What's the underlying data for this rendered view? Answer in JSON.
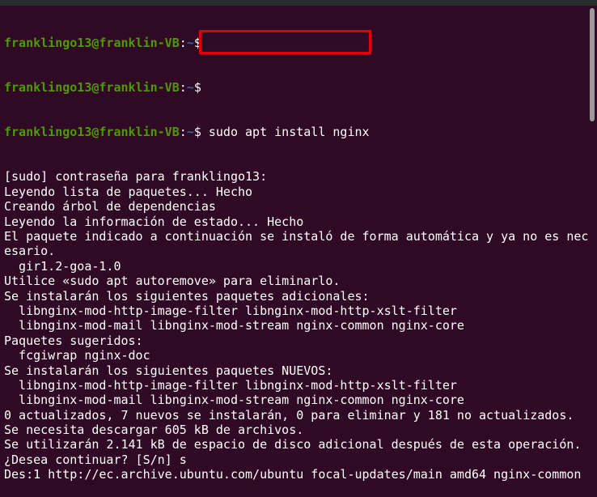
{
  "prompt": {
    "user_host": "franklingo13@franklin-VB",
    "sep": ":",
    "path": "~",
    "symbol": "$"
  },
  "command": "sudo apt install nginx",
  "output_lines": [
    "[sudo] contraseña para franklingo13:",
    "Leyendo lista de paquetes... Hecho",
    "Creando árbol de dependencias",
    "Leyendo la información de estado... Hecho",
    "El paquete indicado a continuación se instaló de forma automática y ya no es nec",
    "esario.",
    "  gir1.2-goa-1.0",
    "Utilice «sudo apt autoremove» para eliminarlo.",
    "Se instalarán los siguientes paquetes adicionales:",
    "  libnginx-mod-http-image-filter libnginx-mod-http-xslt-filter",
    "  libnginx-mod-mail libnginx-mod-stream nginx-common nginx-core",
    "Paquetes sugeridos:",
    "  fcgiwrap nginx-doc",
    "Se instalarán los siguientes paquetes NUEVOS:",
    "  libnginx-mod-http-image-filter libnginx-mod-http-xslt-filter",
    "  libnginx-mod-mail libnginx-mod-stream nginx-common nginx-core",
    "0 actualizados, 7 nuevos se instalarán, 0 para eliminar y 181 no actualizados.",
    "Se necesita descargar 605 kB de archivos.",
    "Se utilizarán 2.141 kB de espacio de disco adicional después de esta operación.",
    "¿Desea continuar? [S/n] s",
    "Des:1 http://ec.archive.ubuntu.com/ubuntu focal-updates/main amd64 nginx-common"
  ],
  "colors": {
    "background": "#300a24",
    "user": "#4e9a06",
    "path": "#3465a4",
    "highlight": "#e00000"
  }
}
